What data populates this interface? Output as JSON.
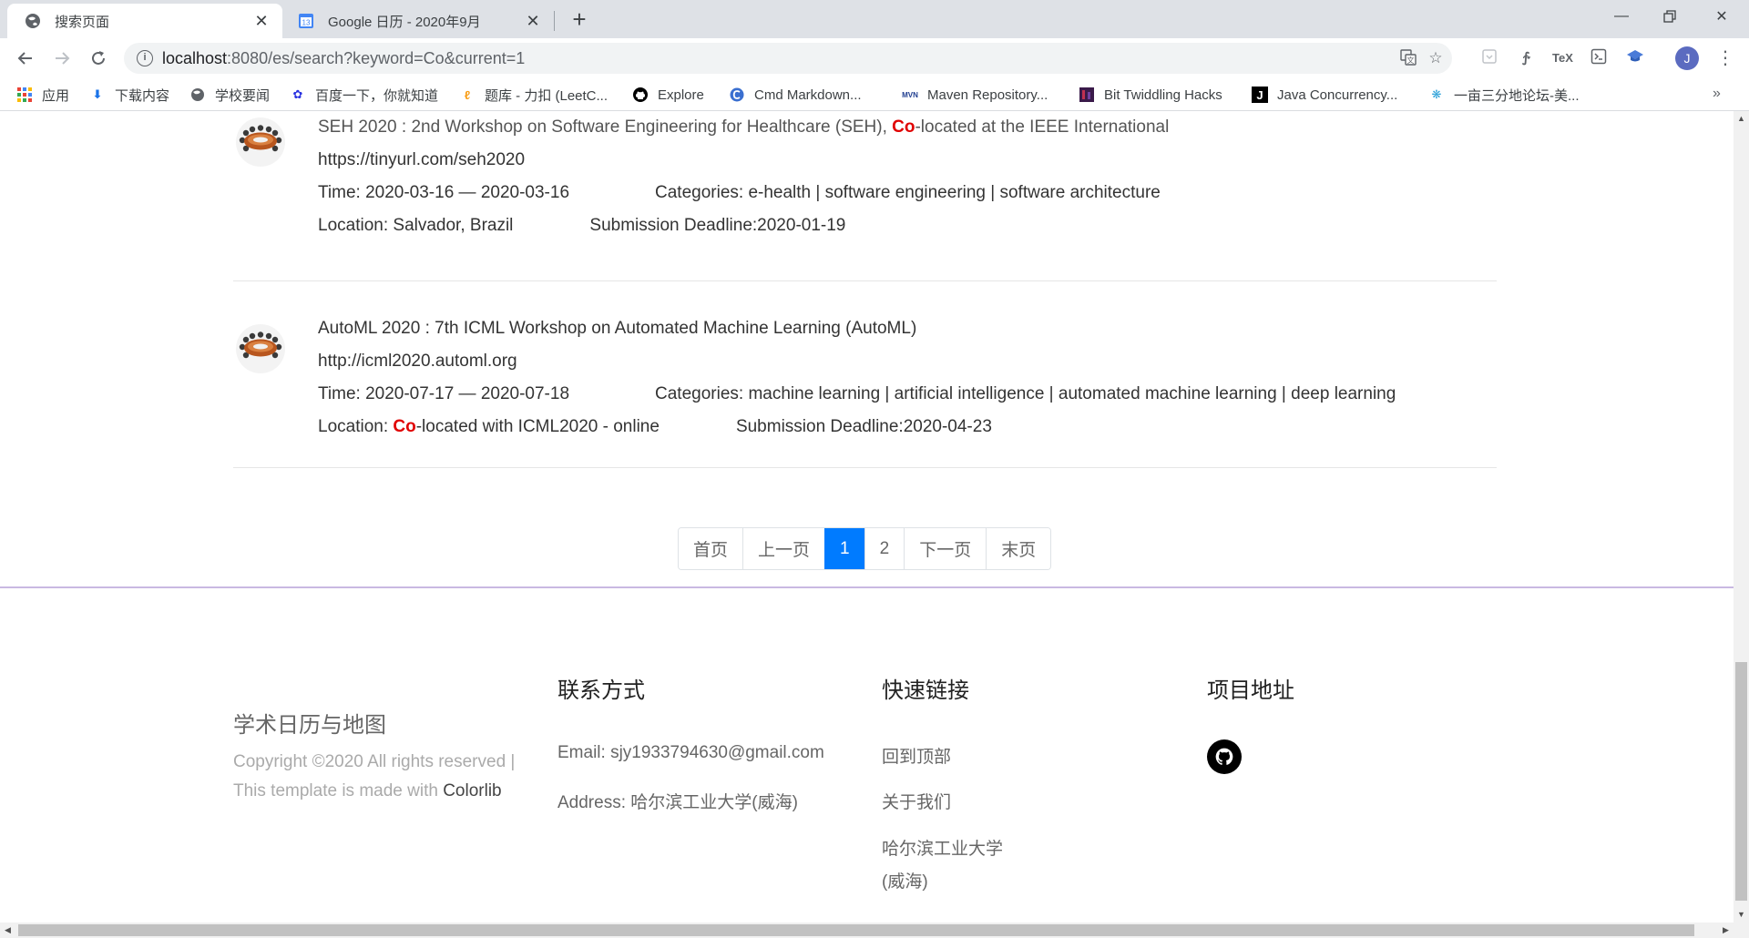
{
  "browser": {
    "tabs": [
      {
        "title": "搜索页面",
        "active": true
      },
      {
        "title": "Google 日历 - 2020年9月",
        "active": false,
        "favicon_text": "13"
      }
    ],
    "url_host": "localhost",
    "url_path": ":8080/es/search?keyword=Co&current=1",
    "avatar_letter": "J",
    "bookmarks": [
      {
        "label": "应用",
        "icon": "apps-grid-icon"
      },
      {
        "label": "下载内容",
        "icon": "download-icon"
      },
      {
        "label": "学校要闻",
        "icon": "globe-icon"
      },
      {
        "label": "百度一下，你就知道",
        "icon": "baidu-paw-icon"
      },
      {
        "label": "题库 - 力扣 (LeetC...",
        "icon": "leetcode-icon"
      },
      {
        "label": "Explore",
        "icon": "github-icon"
      },
      {
        "label": "Cmd Markdown...",
        "icon": "cmd-markdown-icon"
      },
      {
        "label": "Maven Repository...",
        "icon": "maven-icon"
      },
      {
        "label": "Bit Twiddling Hacks",
        "icon": "bit-twiddling-icon"
      },
      {
        "label": "Java Concurrency...",
        "icon": "java-j-icon"
      },
      {
        "label": "一亩三分地论坛-美...",
        "icon": "1point3acres-icon"
      }
    ]
  },
  "results": [
    {
      "title_before": "SEH 2020 : 2nd Workshop on Software Engineering for Healthcare (SEH), ",
      "title_hl": "Co",
      "title_after": "-located at the IEEE International",
      "url": "https://tinyurl.com/seh2020",
      "time": "Time: 2020-03-16 — 2020-03-16",
      "categories": "Categories: e-health | software engineering | software architecture",
      "location_before": "Location: Salvador, Brazil",
      "location_hl": "",
      "location_after": "",
      "deadline": "Submission Deadline:2020-01-19"
    },
    {
      "title_before": "AutoML 2020 : 7th ICML Workshop on Automated Machine Learning (AutoML)",
      "title_hl": "",
      "title_after": "",
      "url": "http://icml2020.automl.org",
      "time": "Time: 2020-07-17 — 2020-07-18",
      "categories": "Categories: machine learning | artificial intelligence | automated machine learning | deep learning",
      "location_before": "Location: ",
      "location_hl": "Co",
      "location_after": "-located with ICML2020 - online",
      "deadline": "Submission Deadline:2020-04-23"
    }
  ],
  "pagination": [
    "首页",
    "上一页",
    "1",
    "2",
    "下一页",
    "末页"
  ],
  "pagination_current": "1",
  "footer": {
    "brand": "学术日历与地图",
    "copyright": "Copyright ©2020 All rights reserved | This template is made with ",
    "colorlib": "Colorlib",
    "contact_heading": "联系方式",
    "email": "Email: sjy1933794630@gmail.com",
    "address": "Address: 哈尔滨工业大学(威海)",
    "links_heading": "快速链接",
    "link_top": "回到顶部",
    "link_about": "关于我们",
    "link_hit_1": "哈尔滨工业大学",
    "link_hit_2": "(威海)",
    "project_heading": "项目地址"
  }
}
